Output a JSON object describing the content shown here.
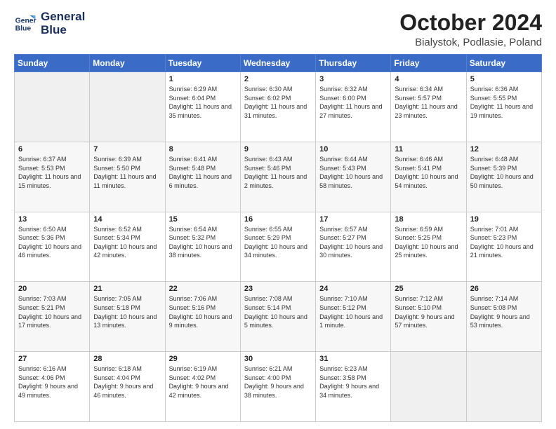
{
  "header": {
    "logo_line1": "General",
    "logo_line2": "Blue",
    "month": "October 2024",
    "location": "Bialystok, Podlasie, Poland"
  },
  "days_of_week": [
    "Sunday",
    "Monday",
    "Tuesday",
    "Wednesday",
    "Thursday",
    "Friday",
    "Saturday"
  ],
  "weeks": [
    [
      {
        "day": "",
        "sunrise": "",
        "sunset": "",
        "daylight": ""
      },
      {
        "day": "",
        "sunrise": "",
        "sunset": "",
        "daylight": ""
      },
      {
        "day": "1",
        "sunrise": "Sunrise: 6:29 AM",
        "sunset": "Sunset: 6:04 PM",
        "daylight": "Daylight: 11 hours and 35 minutes."
      },
      {
        "day": "2",
        "sunrise": "Sunrise: 6:30 AM",
        "sunset": "Sunset: 6:02 PM",
        "daylight": "Daylight: 11 hours and 31 minutes."
      },
      {
        "day": "3",
        "sunrise": "Sunrise: 6:32 AM",
        "sunset": "Sunset: 6:00 PM",
        "daylight": "Daylight: 11 hours and 27 minutes."
      },
      {
        "day": "4",
        "sunrise": "Sunrise: 6:34 AM",
        "sunset": "Sunset: 5:57 PM",
        "daylight": "Daylight: 11 hours and 23 minutes."
      },
      {
        "day": "5",
        "sunrise": "Sunrise: 6:36 AM",
        "sunset": "Sunset: 5:55 PM",
        "daylight": "Daylight: 11 hours and 19 minutes."
      }
    ],
    [
      {
        "day": "6",
        "sunrise": "Sunrise: 6:37 AM",
        "sunset": "Sunset: 5:53 PM",
        "daylight": "Daylight: 11 hours and 15 minutes."
      },
      {
        "day": "7",
        "sunrise": "Sunrise: 6:39 AM",
        "sunset": "Sunset: 5:50 PM",
        "daylight": "Daylight: 11 hours and 11 minutes."
      },
      {
        "day": "8",
        "sunrise": "Sunrise: 6:41 AM",
        "sunset": "Sunset: 5:48 PM",
        "daylight": "Daylight: 11 hours and 6 minutes."
      },
      {
        "day": "9",
        "sunrise": "Sunrise: 6:43 AM",
        "sunset": "Sunset: 5:46 PM",
        "daylight": "Daylight: 11 hours and 2 minutes."
      },
      {
        "day": "10",
        "sunrise": "Sunrise: 6:44 AM",
        "sunset": "Sunset: 5:43 PM",
        "daylight": "Daylight: 10 hours and 58 minutes."
      },
      {
        "day": "11",
        "sunrise": "Sunrise: 6:46 AM",
        "sunset": "Sunset: 5:41 PM",
        "daylight": "Daylight: 10 hours and 54 minutes."
      },
      {
        "day": "12",
        "sunrise": "Sunrise: 6:48 AM",
        "sunset": "Sunset: 5:39 PM",
        "daylight": "Daylight: 10 hours and 50 minutes."
      }
    ],
    [
      {
        "day": "13",
        "sunrise": "Sunrise: 6:50 AM",
        "sunset": "Sunset: 5:36 PM",
        "daylight": "Daylight: 10 hours and 46 minutes."
      },
      {
        "day": "14",
        "sunrise": "Sunrise: 6:52 AM",
        "sunset": "Sunset: 5:34 PM",
        "daylight": "Daylight: 10 hours and 42 minutes."
      },
      {
        "day": "15",
        "sunrise": "Sunrise: 6:54 AM",
        "sunset": "Sunset: 5:32 PM",
        "daylight": "Daylight: 10 hours and 38 minutes."
      },
      {
        "day": "16",
        "sunrise": "Sunrise: 6:55 AM",
        "sunset": "Sunset: 5:29 PM",
        "daylight": "Daylight: 10 hours and 34 minutes."
      },
      {
        "day": "17",
        "sunrise": "Sunrise: 6:57 AM",
        "sunset": "Sunset: 5:27 PM",
        "daylight": "Daylight: 10 hours and 30 minutes."
      },
      {
        "day": "18",
        "sunrise": "Sunrise: 6:59 AM",
        "sunset": "Sunset: 5:25 PM",
        "daylight": "Daylight: 10 hours and 25 minutes."
      },
      {
        "day": "19",
        "sunrise": "Sunrise: 7:01 AM",
        "sunset": "Sunset: 5:23 PM",
        "daylight": "Daylight: 10 hours and 21 minutes."
      }
    ],
    [
      {
        "day": "20",
        "sunrise": "Sunrise: 7:03 AM",
        "sunset": "Sunset: 5:21 PM",
        "daylight": "Daylight: 10 hours and 17 minutes."
      },
      {
        "day": "21",
        "sunrise": "Sunrise: 7:05 AM",
        "sunset": "Sunset: 5:18 PM",
        "daylight": "Daylight: 10 hours and 13 minutes."
      },
      {
        "day": "22",
        "sunrise": "Sunrise: 7:06 AM",
        "sunset": "Sunset: 5:16 PM",
        "daylight": "Daylight: 10 hours and 9 minutes."
      },
      {
        "day": "23",
        "sunrise": "Sunrise: 7:08 AM",
        "sunset": "Sunset: 5:14 PM",
        "daylight": "Daylight: 10 hours and 5 minutes."
      },
      {
        "day": "24",
        "sunrise": "Sunrise: 7:10 AM",
        "sunset": "Sunset: 5:12 PM",
        "daylight": "Daylight: 10 hours and 1 minute."
      },
      {
        "day": "25",
        "sunrise": "Sunrise: 7:12 AM",
        "sunset": "Sunset: 5:10 PM",
        "daylight": "Daylight: 9 hours and 57 minutes."
      },
      {
        "day": "26",
        "sunrise": "Sunrise: 7:14 AM",
        "sunset": "Sunset: 5:08 PM",
        "daylight": "Daylight: 9 hours and 53 minutes."
      }
    ],
    [
      {
        "day": "27",
        "sunrise": "Sunrise: 6:16 AM",
        "sunset": "Sunset: 4:06 PM",
        "daylight": "Daylight: 9 hours and 49 minutes."
      },
      {
        "day": "28",
        "sunrise": "Sunrise: 6:18 AM",
        "sunset": "Sunset: 4:04 PM",
        "daylight": "Daylight: 9 hours and 46 minutes."
      },
      {
        "day": "29",
        "sunrise": "Sunrise: 6:19 AM",
        "sunset": "Sunset: 4:02 PM",
        "daylight": "Daylight: 9 hours and 42 minutes."
      },
      {
        "day": "30",
        "sunrise": "Sunrise: 6:21 AM",
        "sunset": "Sunset: 4:00 PM",
        "daylight": "Daylight: 9 hours and 38 minutes."
      },
      {
        "day": "31",
        "sunrise": "Sunrise: 6:23 AM",
        "sunset": "Sunset: 3:58 PM",
        "daylight": "Daylight: 9 hours and 34 minutes."
      },
      {
        "day": "",
        "sunrise": "",
        "sunset": "",
        "daylight": ""
      },
      {
        "day": "",
        "sunrise": "",
        "sunset": "",
        "daylight": ""
      }
    ]
  ]
}
